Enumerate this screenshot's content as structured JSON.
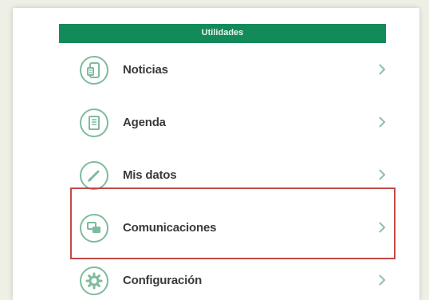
{
  "header": {
    "title": "Utilidades"
  },
  "menu": {
    "items": [
      {
        "label": "Noticias",
        "icon": "phone-news-icon"
      },
      {
        "label": "Agenda",
        "icon": "notebook-icon"
      },
      {
        "label": "Mis datos",
        "icon": "pencil-icon"
      },
      {
        "label": "Comunicaciones",
        "icon": "chat-bubbles-icon"
      },
      {
        "label": "Configuración",
        "icon": "gear-icon"
      }
    ]
  },
  "highlight": {
    "target": "Comunicaciones",
    "color": "#c04a45"
  },
  "colors": {
    "accent": "#138a5a",
    "icon_stroke": "#7fbb9c"
  }
}
